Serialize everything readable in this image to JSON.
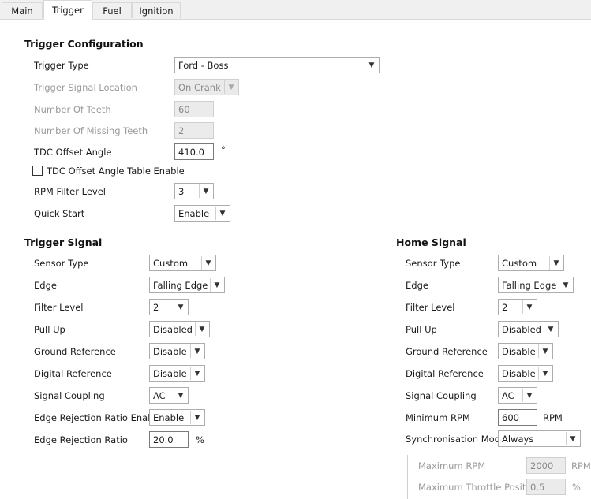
{
  "tabs": [
    "Main",
    "Trigger",
    "Fuel",
    "Ignition"
  ],
  "trigger_config": {
    "title": "Trigger Configuration",
    "trigger_type_label": "Trigger Type",
    "trigger_type_value": "Ford - Boss",
    "signal_location_label": "Trigger Signal Location",
    "signal_location_value": "On Crank",
    "num_teeth_label": "Number Of Teeth",
    "num_teeth_value": "60",
    "missing_teeth_label": "Number Of Missing Teeth",
    "missing_teeth_value": "2",
    "tdc_offset_label": "TDC Offset Angle",
    "tdc_offset_value": "410.0",
    "tdc_offset_unit": "°",
    "tdc_table_enable_label": "TDC Offset Angle Table Enable",
    "rpm_filter_label": "RPM Filter Level",
    "rpm_filter_value": "3",
    "quick_start_label": "Quick Start",
    "quick_start_value": "Enable"
  },
  "trigger_signal": {
    "title": "Trigger Signal",
    "sensor_type_label": "Sensor Type",
    "sensor_type_value": "Custom",
    "edge_label": "Edge",
    "edge_value": "Falling Edge",
    "filter_level_label": "Filter Level",
    "filter_level_value": "2",
    "pull_up_label": "Pull Up",
    "pull_up_value": "Disabled",
    "ground_ref_label": "Ground Reference",
    "ground_ref_value": "Disable",
    "digital_ref_label": "Digital Reference",
    "digital_ref_value": "Disable",
    "coupling_label": "Signal Coupling",
    "coupling_value": "AC",
    "edge_rej_enable_label": "Edge Rejection Ratio Enable",
    "edge_rej_enable_value": "Enable",
    "edge_rej_ratio_label": "Edge Rejection Ratio",
    "edge_rej_ratio_value": "20.0",
    "edge_rej_ratio_unit": "%"
  },
  "home_signal": {
    "title": "Home Signal",
    "sensor_type_label": "Sensor Type",
    "sensor_type_value": "Custom",
    "edge_label": "Edge",
    "edge_value": "Falling Edge",
    "filter_level_label": "Filter Level",
    "filter_level_value": "2",
    "pull_up_label": "Pull Up",
    "pull_up_value": "Disabled",
    "ground_ref_label": "Ground Reference",
    "ground_ref_value": "Disable",
    "digital_ref_label": "Digital Reference",
    "digital_ref_value": "Disable",
    "coupling_label": "Signal Coupling",
    "coupling_value": "AC",
    "min_rpm_label": "Minimum RPM",
    "min_rpm_value": "600",
    "min_rpm_unit": "RPM",
    "sync_mode_label": "Synchronisation Mode",
    "sync_mode_value": "Always",
    "max_rpm_label": "Maximum RPM",
    "max_rpm_value": "2000",
    "max_rpm_unit": "RPM",
    "max_tp_label": "Maximum Throttle Position",
    "max_tp_value": "0.5",
    "max_tp_unit": "%"
  }
}
